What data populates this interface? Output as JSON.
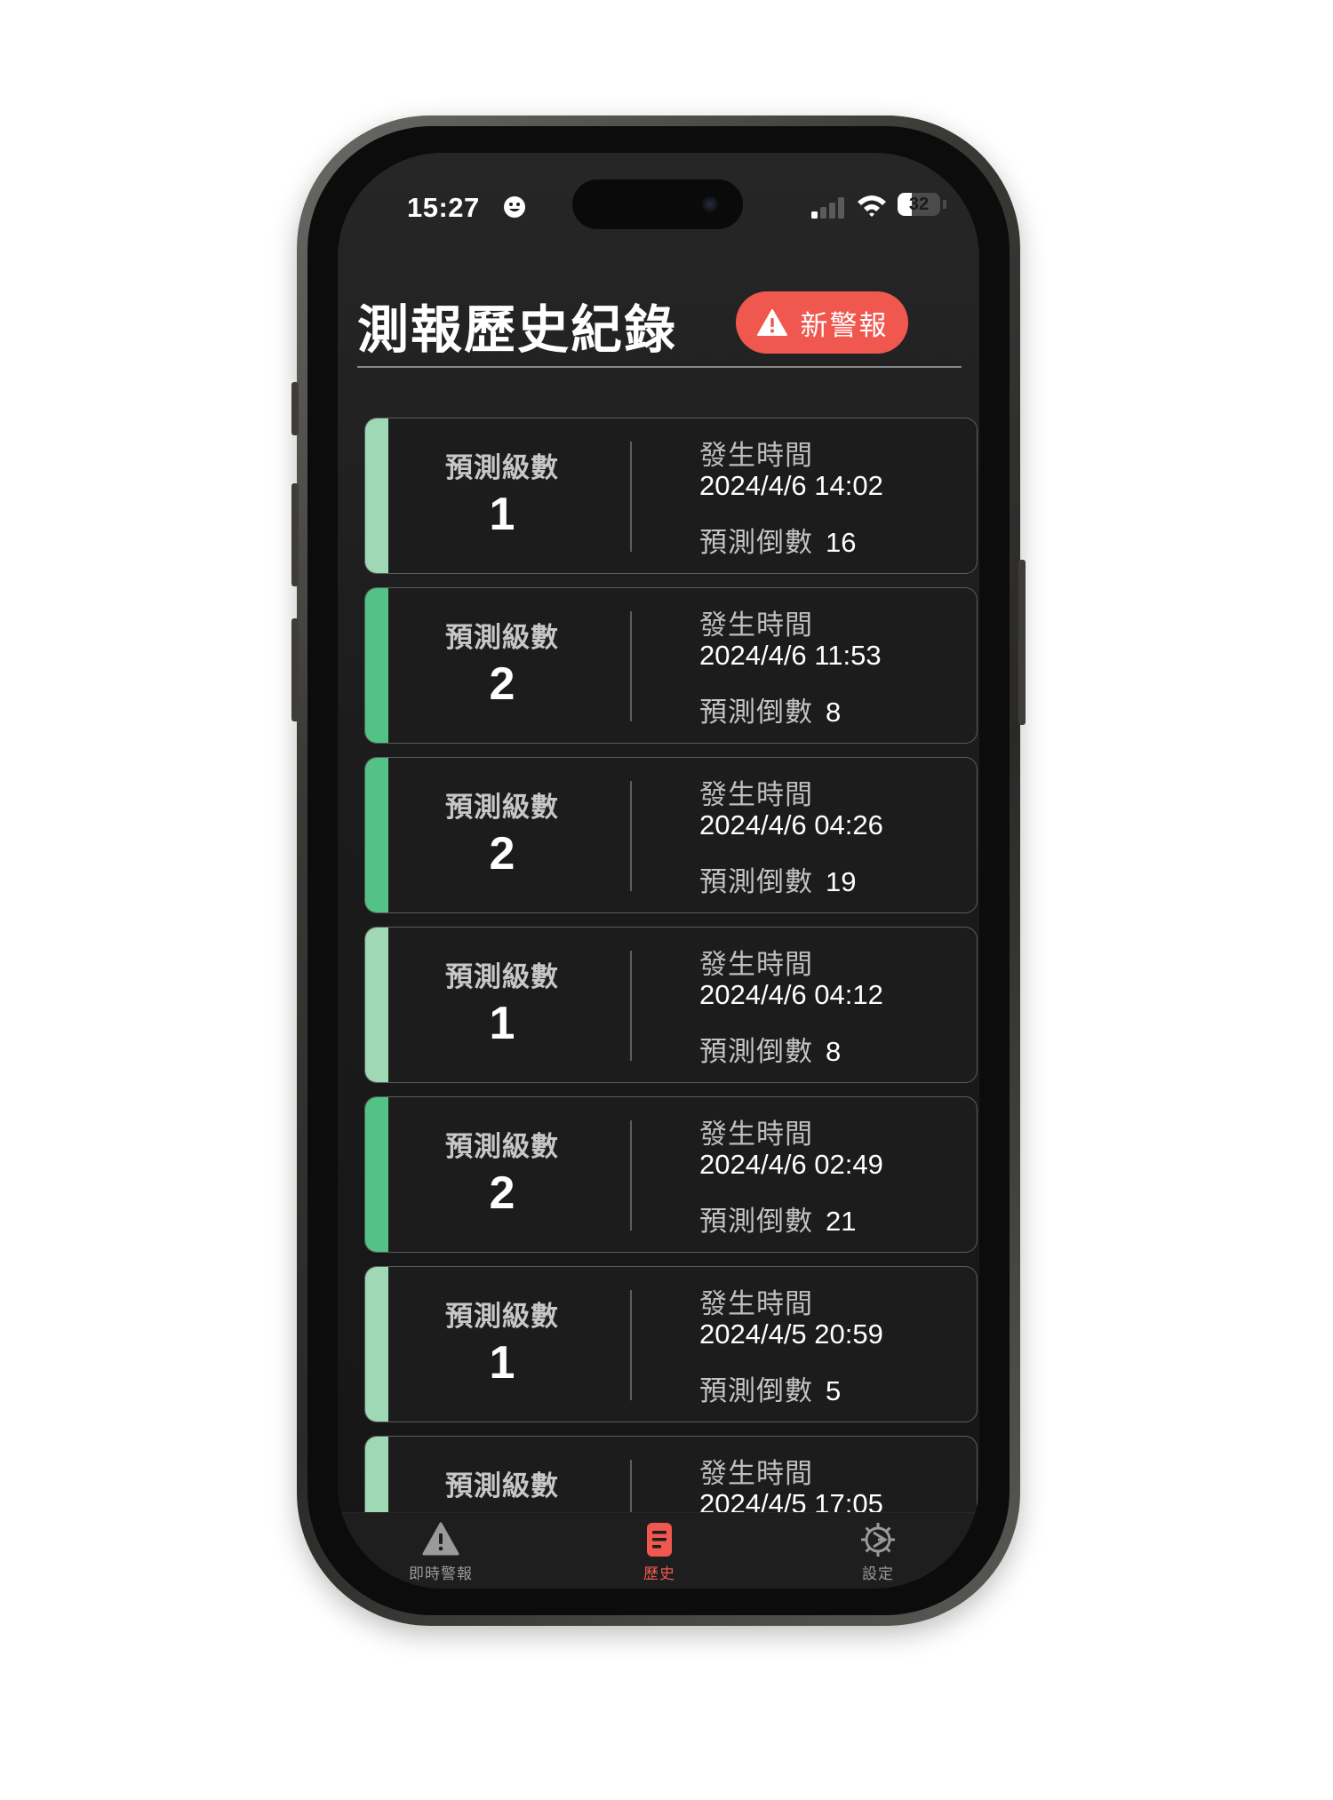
{
  "status_bar": {
    "time": "15:27",
    "battery": "32"
  },
  "header": {
    "title": "測報歷史紀錄",
    "new_alert_label": "新警報"
  },
  "colors": {
    "accent_red": "#f0574f",
    "level_1": "#9ed8b4",
    "level_2": "#52c285"
  },
  "records": [
    {
      "level_label": "預測級數",
      "level": "1",
      "time_label": "發生時間",
      "time": "2024/4/6 14:02",
      "countdown_label": "預測倒數",
      "countdown": "16"
    },
    {
      "level_label": "預測級數",
      "level": "2",
      "time_label": "發生時間",
      "time": "2024/4/6 11:53",
      "countdown_label": "預測倒數",
      "countdown": "8"
    },
    {
      "level_label": "預測級數",
      "level": "2",
      "time_label": "發生時間",
      "time": "2024/4/6 04:26",
      "countdown_label": "預測倒數",
      "countdown": "19"
    },
    {
      "level_label": "預測級數",
      "level": "1",
      "time_label": "發生時間",
      "time": "2024/4/6 04:12",
      "countdown_label": "預測倒數",
      "countdown": "8"
    },
    {
      "level_label": "預測級數",
      "level": "2",
      "time_label": "發生時間",
      "time": "2024/4/6 02:49",
      "countdown_label": "預測倒數",
      "countdown": "21"
    },
    {
      "level_label": "預測級數",
      "level": "1",
      "time_label": "發生時間",
      "time": "2024/4/5 20:59",
      "countdown_label": "預測倒數",
      "countdown": "5"
    },
    {
      "level_label": "預測級數",
      "level": "",
      "time_label": "發生時間",
      "time": "2024/4/5 17:05",
      "countdown_label": "",
      "countdown": ""
    }
  ],
  "tabs": [
    {
      "label": "即時警報",
      "icon": "warning-icon",
      "active": false
    },
    {
      "label": "歷史",
      "icon": "document-icon",
      "active": true
    },
    {
      "label": "設定",
      "icon": "gear-icon",
      "active": false
    }
  ]
}
